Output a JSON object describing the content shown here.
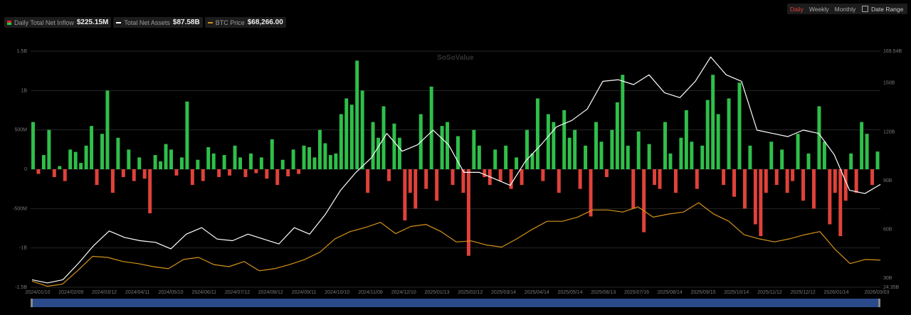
{
  "legend": {
    "inflow": {
      "label": "Daily Total Net Inflow",
      "value": "$225.15M"
    },
    "assets": {
      "label": "Total Net Assets",
      "value": "$87.58B"
    },
    "btc": {
      "label": "BTC Price",
      "value": "$68,266.00"
    }
  },
  "controls": {
    "periods": [
      "Daily",
      "Weekly",
      "Monthly"
    ],
    "active_period": "Daily",
    "date_range_label": "Date Range",
    "date_range_icon": "calendar-icon"
  },
  "watermark": "SoSoValue",
  "colors": {
    "positive": "#2fbf4a",
    "negative": "#e0423a",
    "assets": "#ffffff",
    "btc": "#d4921a",
    "navigator": "#2a4a8a"
  },
  "chart_data": {
    "type": "bar+line",
    "title": "",
    "x_tick_labels": [
      "2024/01/10",
      "2024/02/09",
      "2024/03/12",
      "2024/04/11",
      "2024/05/10",
      "2024/06/11",
      "2024/07/12",
      "2024/08/12",
      "2024/09/11",
      "2024/10/10",
      "2024/11/08",
      "2024/12/10",
      "2025/01/13",
      "2025/02/12",
      "2025/03/14",
      "2025/04/14",
      "2025/05/14",
      "2025/06/13",
      "2025/07/16",
      "2025/08/14",
      "2025/09/15",
      "2025/10/14",
      "2025/11/12",
      "2025/12/12",
      "2026/01/14",
      "2026/03/03"
    ],
    "left_axis": {
      "unit": "USD",
      "range": [
        -1500000000,
        1500000000
      ],
      "ticks": [
        "1.5B",
        "1B",
        "500M",
        "0",
        "-500M",
        "-1B",
        "-1.5B"
      ]
    },
    "right_axis": {
      "unit": "USD B",
      "range": [
        24.35,
        169.54
      ],
      "ticks": [
        {
          "label": "169.54B",
          "v": 169.54
        },
        {
          "label": "150B",
          "v": 150
        },
        {
          "label": "120B",
          "v": 120
        },
        {
          "label": "90B",
          "v": 90
        },
        {
          "label": "60B",
          "v": 60
        },
        {
          "label": "30B",
          "v": 30
        },
        {
          "label": "24.35B",
          "v": 24.35
        }
      ]
    },
    "btc_axis_range": [
      42000,
      271000
    ],
    "series": [
      {
        "name": "Daily Total Net Inflow",
        "type": "bar",
        "unit": "M USD",
        "values": [
          600,
          -60,
          180,
          500,
          -100,
          40,
          -150,
          250,
          220,
          80,
          300,
          550,
          -200,
          450,
          1000,
          -300,
          400,
          -100,
          250,
          -150,
          150,
          -120,
          -560,
          180,
          100,
          320,
          250,
          -80,
          150,
          860,
          -200,
          120,
          -150,
          280,
          200,
          -100,
          180,
          -80,
          300,
          150,
          -100,
          200,
          -50,
          150,
          -120,
          380,
          -200,
          120,
          -90,
          250,
          -60,
          300,
          280,
          150,
          500,
          330,
          180,
          200,
          700,
          900,
          820,
          1380,
          1000,
          -300,
          600,
          400,
          800,
          -150,
          580,
          400,
          -650,
          -300,
          -500,
          700,
          -250,
          1050,
          -400,
          550,
          600,
          -200,
          420,
          -300,
          -1100,
          500,
          300,
          -100,
          -200,
          250,
          -150,
          300,
          -250,
          150,
          -200,
          500,
          200,
          900,
          -150,
          700,
          600,
          -300,
          750,
          400,
          500,
          -250,
          300,
          -600,
          600,
          350,
          -100,
          500,
          850,
          1200,
          300,
          -500,
          480,
          -800,
          320,
          -200,
          -250,
          600,
          200,
          -300,
          400,
          750,
          350,
          -250,
          300,
          880,
          1200,
          700,
          -200,
          900,
          -350,
          1100,
          -500,
          300,
          -700,
          -850,
          -300,
          350,
          -200,
          250,
          -300,
          -150,
          450,
          -400,
          200,
          -500,
          800,
          350,
          -700,
          -300,
          -850,
          -400,
          200,
          -300,
          600,
          450,
          -200,
          225
        ]
      },
      {
        "name": "Total Net Assets",
        "type": "line",
        "unit": "B USD",
        "values": [
          29,
          27,
          29,
          39,
          50,
          59,
          55,
          53,
          52,
          48,
          57,
          61,
          54,
          53,
          57,
          54,
          51,
          61,
          57,
          69,
          84,
          95,
          104,
          119,
          108,
          112,
          121,
          112,
          95,
          95,
          91,
          87,
          102,
          112,
          123,
          127,
          134,
          151,
          152,
          149,
          155,
          144,
          141,
          151,
          166,
          155,
          151,
          121,
          119,
          117,
          121,
          119,
          106,
          84,
          82,
          87.58
        ]
      },
      {
        "name": "BTC Price",
        "type": "line",
        "unit": "K USD",
        "values": [
          48,
          43,
          45,
          58,
          72,
          71,
          67,
          65,
          62,
          60,
          69,
          71,
          64,
          62,
          67,
          58,
          60,
          64,
          69,
          76,
          89,
          96,
          100,
          105,
          94,
          101,
          103,
          96,
          86,
          87,
          83,
          81,
          89,
          98,
          106,
          106,
          110,
          117,
          117,
          115,
          120,
          110,
          113,
          115,
          124,
          113,
          106,
          93,
          89,
          86,
          89,
          93,
          96,
          79,
          65,
          69,
          68.266
        ]
      }
    ]
  }
}
